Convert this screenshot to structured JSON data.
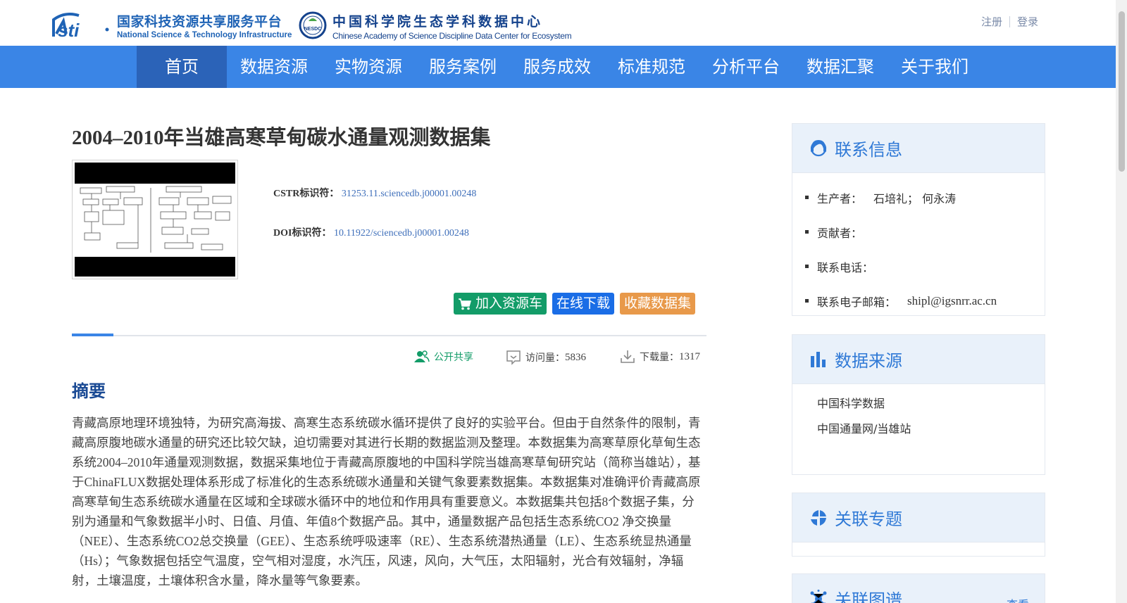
{
  "header": {
    "logo1_cn": "国家科技资源共享服务平台",
    "logo1_en": "National Science & Technology Infrastructure",
    "logo2_cn": "中国科学院生态学科数据中心",
    "logo2_en": "Chinese Academy of Science Discipline Data Center for Ecosystem",
    "logo2_badge": "NESDC",
    "register": "注册",
    "login": "登录"
  },
  "nav": [
    "首页",
    "数据资源",
    "实物资源",
    "服务案例",
    "服务成效",
    "标准规范",
    "分析平台",
    "数据汇聚",
    "关于我们"
  ],
  "dataset": {
    "title": "2004–2010年当雄高寒草甸碳水通量观测数据集",
    "cstr_label": "CSTR标识符：",
    "cstr_value": "31253.11.sciencedb.j00001.00248",
    "doi_label": "DOI标识符：",
    "doi_value": "10.11922/sciencedb.j00001.00248",
    "btn_cart": "加入资源车",
    "btn_download": "在线下载",
    "btn_favorite": "收藏数据集",
    "share": "公开共享",
    "visits_label": "访问量：",
    "visits": "5836",
    "downloads_label": "下载量：",
    "downloads": "1317",
    "abstract_heading": "摘要",
    "abstract": "青藏高原地理环境独特，为研究高海拔、高寒生态系统碳水循环提供了良好的实验平台。但由于自然条件的限制，青藏高原腹地碳水通量的研究还比较欠缺，迫切需要对其进行长期的数据监测及整理。本数据集为高寒草原化草甸生态系统2004–2010年通量观测数据，数据采集地位于青藏高原腹地的中国科学院当雄高寒草甸研究站（简称当雄站），基于ChinaFLUX数据处理体系形成了标准化的生态系统碳水通量和关键气象要素数据集。本数据集对准确评价青藏高原高寒草甸生态系统碳水通量在区域和全球碳水循环中的地位和作用具有重要意义。本数据集共包括8个数据子集，分别为通量和气象数据半小时、日值、月值、年值8个数据产品。其中，通量数据产品包括生态系统CO2 净交换量（NEE）、生态系统CO2总交换量（GEE）、生态系统呼吸速率（RE）、生态系统潜热通量（LE）、生态系统显热通量（Hs）；气象数据包括空气温度，空气相对湿度，水汽压，风速，风向，大气压，太阳辐射，光合有效辐射，净辐射，土壤温度，土壤体积含水量，降水量等气象要素。"
  },
  "sidebar": {
    "contact": {
      "title": "联系信息",
      "producer_label": "生产者：",
      "producer": "石培礼； 何永涛",
      "contributor_label": "贡献者：",
      "phone_label": "联系电话：",
      "email_label": "联系电子邮箱：",
      "email": "shipl@igsnrr.ac.cn"
    },
    "source": {
      "title": "数据来源",
      "items": [
        "中国科学数据",
        "中国通量网/当雄站"
      ]
    },
    "topic": {
      "title": "关联专题"
    },
    "graph": {
      "title": "关联图谱",
      "more": "查看"
    }
  },
  "colors": {
    "nav": "#3a85e6",
    "nav_active": "#2b63b8",
    "btn_cart": "#139c68",
    "btn_download": "#1a6de6",
    "btn_favorite": "#e8994a",
    "sidebar_title": "#2f79d6"
  }
}
